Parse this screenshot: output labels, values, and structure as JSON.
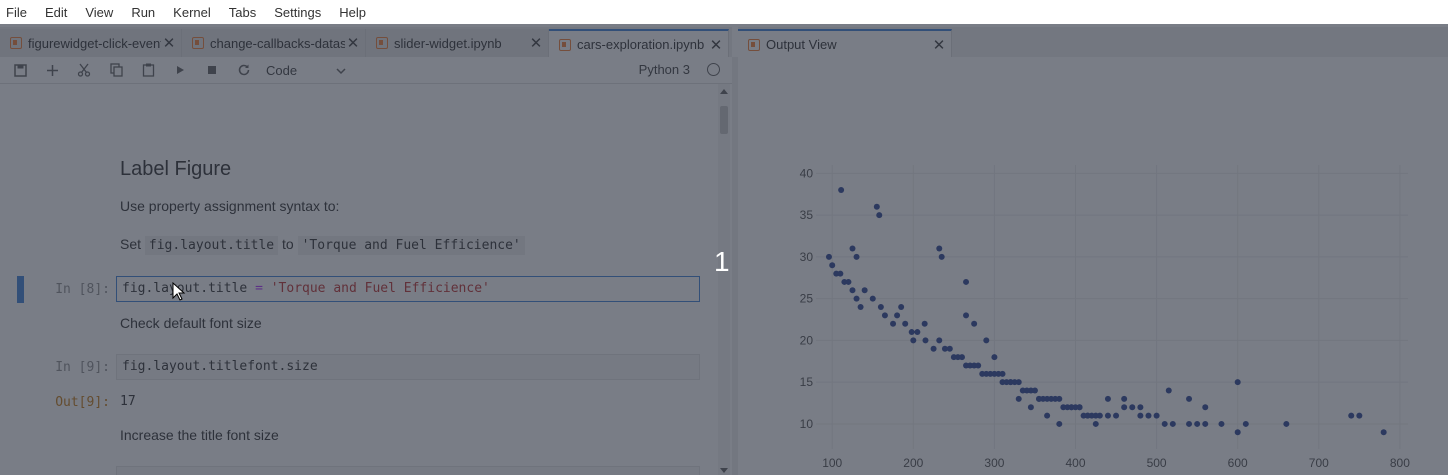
{
  "menu": [
    "File",
    "Edit",
    "View",
    "Run",
    "Kernel",
    "Tabs",
    "Settings",
    "Help"
  ],
  "tabs": [
    {
      "label": "figurewidget-click-events.ipynb",
      "active": false
    },
    {
      "label": "change-callbacks-datashader.ipynb",
      "active": false
    },
    {
      "label": "slider-widget.ipynb",
      "active": false
    },
    {
      "label": "cars-exploration.ipynb",
      "active": true
    }
  ],
  "output_tab": {
    "label": "Output View"
  },
  "toolbar": {
    "cell_type": "Code",
    "kernel": "Python 3"
  },
  "notebook": {
    "heading": "Label Figure",
    "intro": "Use property assignment syntax to:",
    "set_prefix": "Set",
    "set_code1": "fig.layout.title",
    "set_to": "to",
    "set_code2": "'Torque and Fuel Efficience'",
    "in8_prompt": "In [8]:",
    "in8_code_a": "fig.layout.title",
    "in8_code_op": "=",
    "in8_code_str": "'Torque and Fuel Efficience'",
    "check_text": "Check default font size",
    "in9_prompt": "In [9]:",
    "in9_code": "fig.layout.titlefont.size",
    "out9_prompt": "Out[9]:",
    "out9_value": "17",
    "increase_text": "Increase the title font size"
  },
  "overlay_text": "1",
  "colors": {
    "accent": "#2f7ad6",
    "marker": "#1f3a8c",
    "overlay": "#343a48"
  },
  "chart_data": {
    "type": "scatter",
    "title": "",
    "xlabel": "",
    "ylabel": "",
    "xlim": [
      80,
      810
    ],
    "ylim": [
      7,
      41
    ],
    "xticks": [
      100,
      200,
      300,
      400,
      500,
      600,
      700,
      800
    ],
    "yticks": [
      10,
      15,
      20,
      25,
      30,
      35,
      40
    ],
    "grid": true,
    "series": [
      {
        "x": [
          111,
          155,
          158,
          125,
          130,
          232,
          235,
          265,
          96,
          100,
          105,
          110,
          115,
          120,
          125,
          130,
          135,
          140,
          150,
          160,
          165,
          175,
          180,
          185,
          190,
          198,
          200,
          205,
          214,
          215,
          225,
          232,
          239,
          245,
          250,
          255,
          260,
          265,
          270,
          275,
          280,
          285,
          290,
          295,
          300,
          305,
          310,
          315,
          320,
          325,
          330,
          335,
          340,
          345,
          350,
          355,
          360,
          365,
          370,
          375,
          380,
          385,
          390,
          395,
          400,
          405,
          410,
          415,
          420,
          425,
          430,
          440,
          450,
          460,
          470,
          480,
          490,
          500,
          510,
          520,
          540,
          550,
          560,
          580,
          600,
          610,
          660,
          740,
          750,
          780,
          265,
          275,
          290,
          300,
          310,
          320,
          330,
          345,
          355,
          365,
          380,
          395,
          405,
          415,
          425,
          440,
          460,
          480,
          515,
          540,
          560,
          600
        ],
        "y": [
          38,
          36,
          35,
          31,
          30,
          31,
          30,
          27,
          30,
          29,
          28,
          28,
          27,
          27,
          26,
          25,
          24,
          26,
          25,
          24,
          23,
          22,
          23,
          24,
          22,
          21,
          20,
          21,
          22,
          20,
          19,
          20,
          19,
          19,
          18,
          18,
          18,
          17,
          17,
          17,
          17,
          16,
          16,
          16,
          16,
          16,
          15,
          15,
          15,
          15,
          15,
          14,
          14,
          14,
          14,
          13,
          13,
          13,
          13,
          13,
          13,
          12,
          12,
          12,
          12,
          12,
          11,
          11,
          11,
          11,
          11,
          11,
          11,
          12,
          12,
          11,
          11,
          11,
          10,
          10,
          10,
          10,
          10,
          10,
          9,
          10,
          10,
          11,
          11,
          9,
          23,
          22,
          20,
          18,
          16,
          15,
          13,
          12,
          13,
          11,
          10,
          12,
          12,
          11,
          10,
          13,
          13,
          12,
          14,
          13,
          12,
          15
        ]
      }
    ]
  }
}
